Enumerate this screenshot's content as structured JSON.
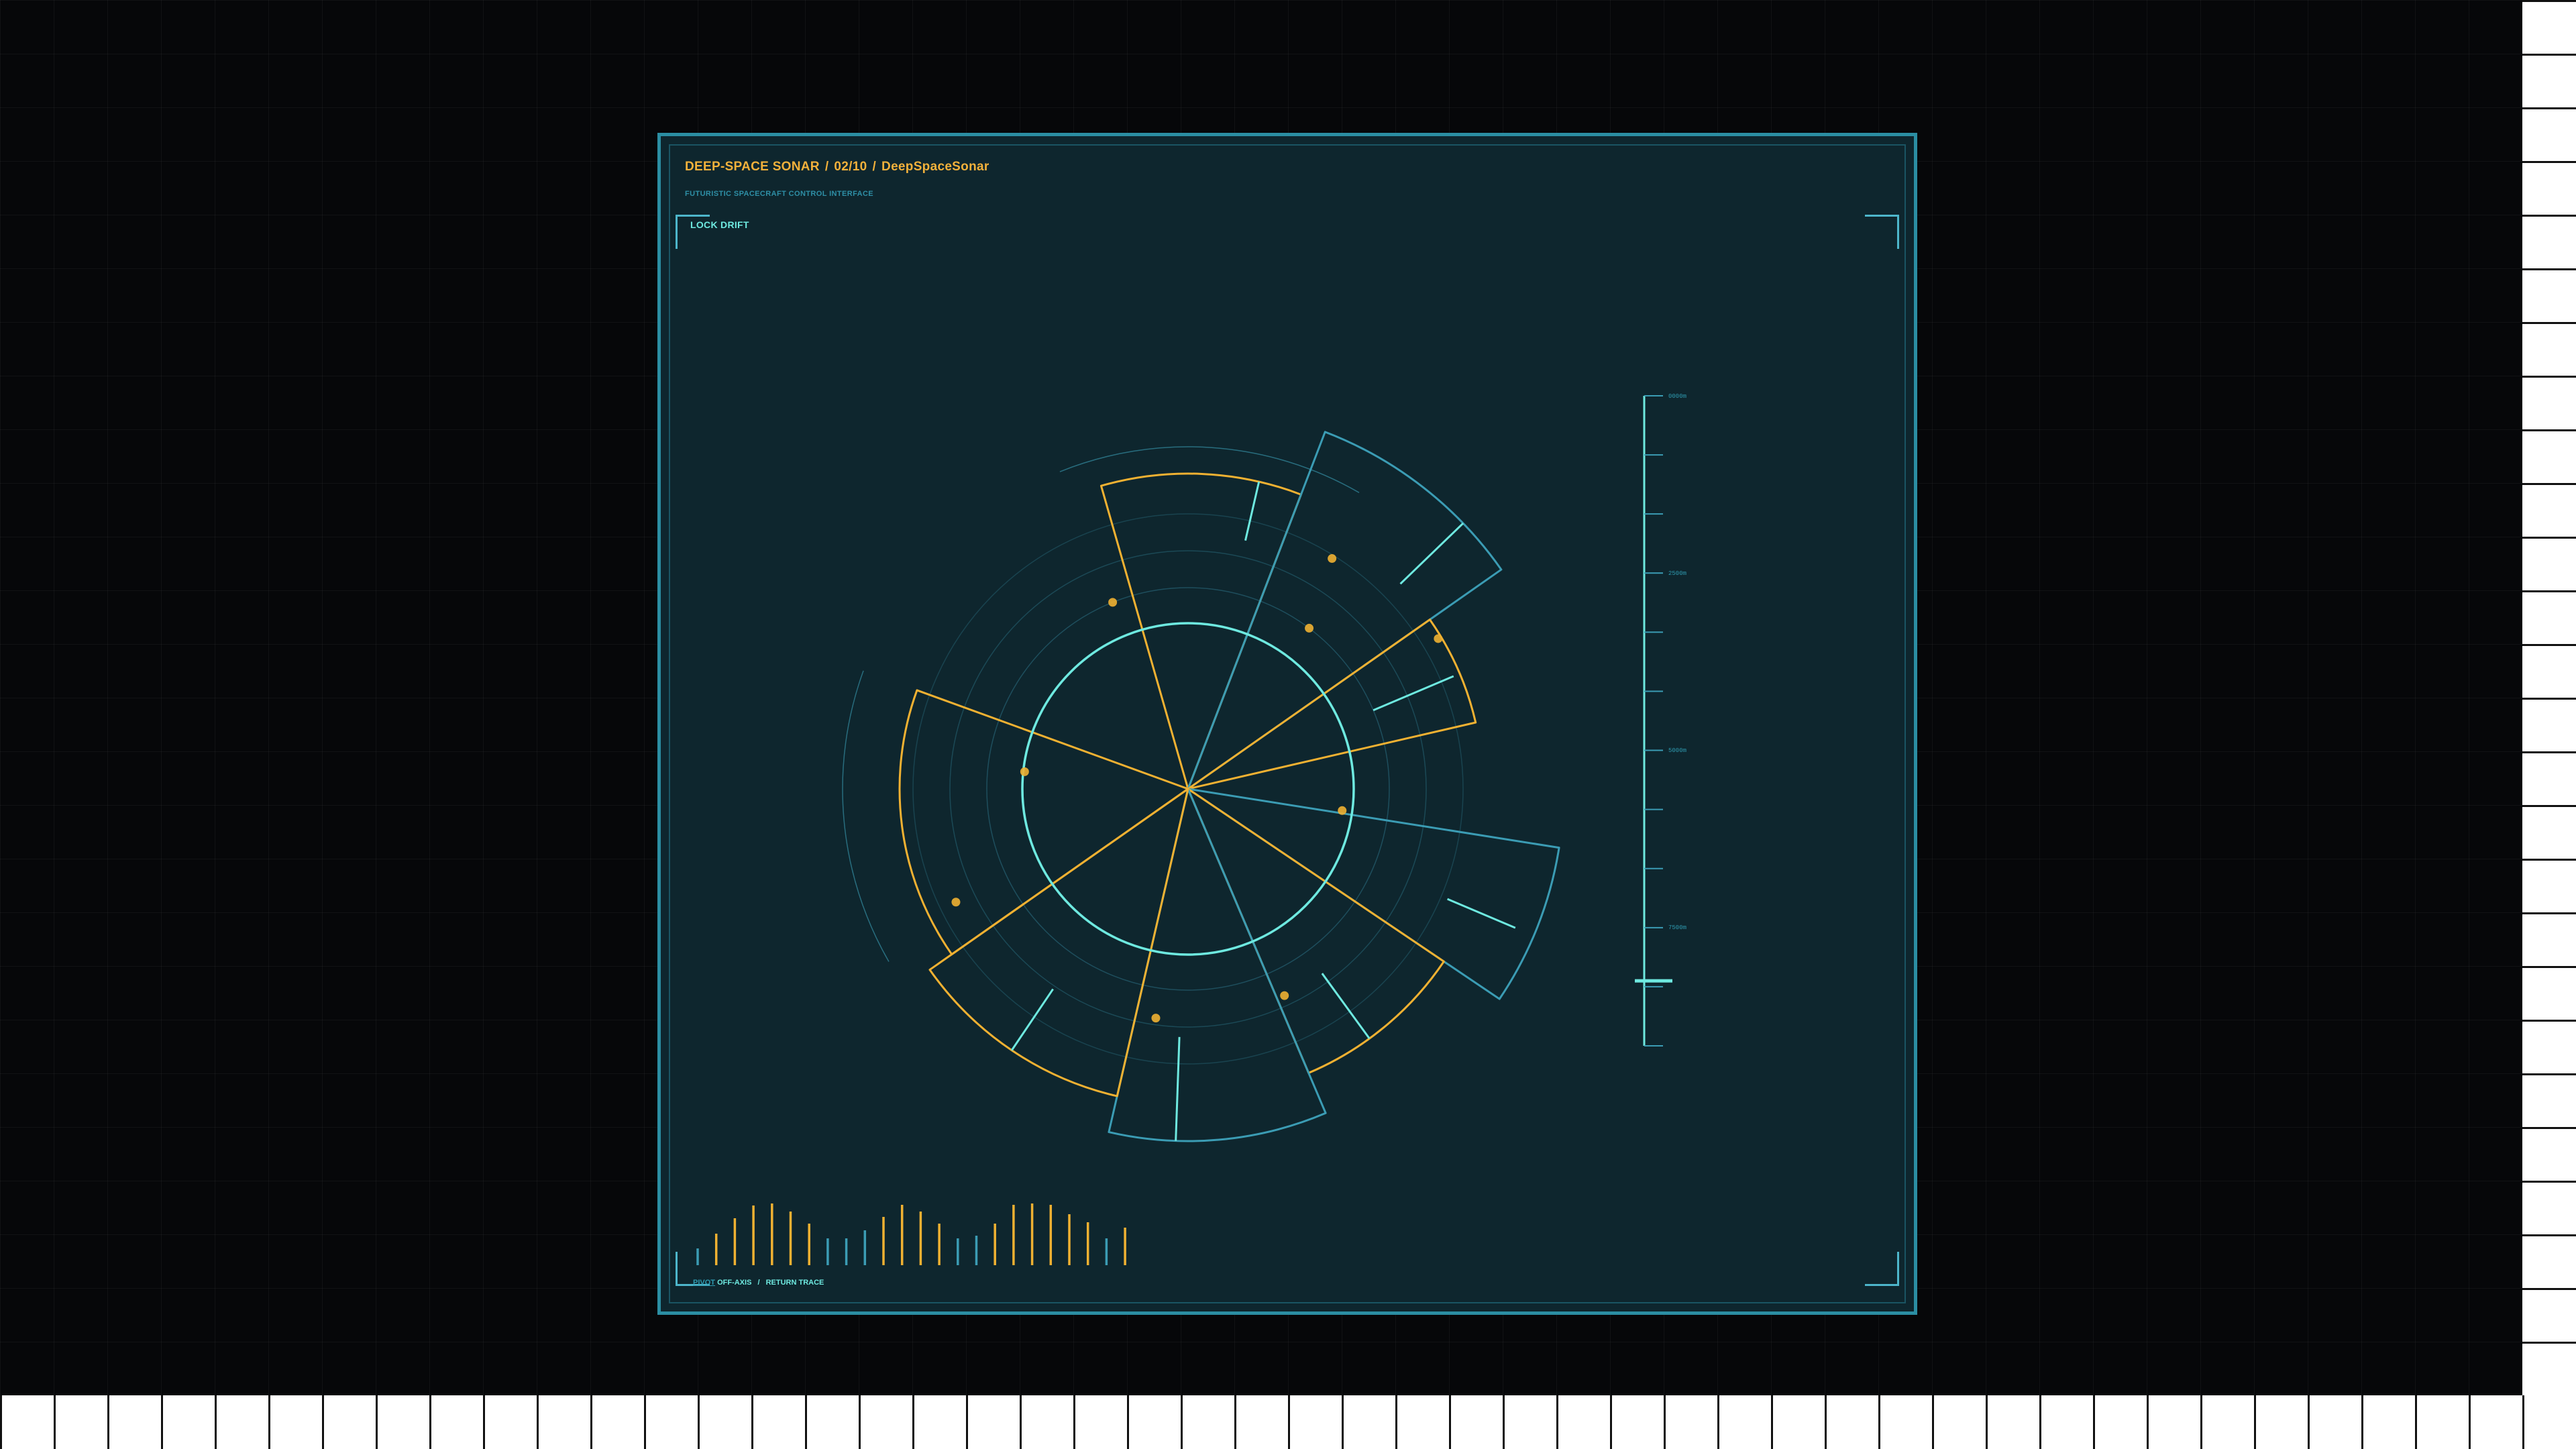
{
  "header": {
    "title_app": "DEEP-SPACE SONAR",
    "title_index": "02/10",
    "title_name": "DeepSpaceSonar",
    "subtitle": "FUTURISTIC SPACECRAFT CONTROL INTERFACE"
  },
  "controls": {
    "lock_label": "LOCK DRIFT"
  },
  "footer": {
    "pivot_label": "PIVOT",
    "off_axis_label": "OFF-AXIS",
    "return_label": "RETURN TRACE"
  },
  "depth_scale": {
    "labels": [
      "0000m",
      "2500m",
      "5000m",
      "7500m"
    ],
    "marker_fraction": 0.9
  },
  "colors": {
    "background": "#060709",
    "panel": "#0e262e",
    "frame": "#2b8ea3",
    "amber": "#f0b132",
    "cyan": "#6ee9e0",
    "blue": "#3b9cb4"
  }
}
